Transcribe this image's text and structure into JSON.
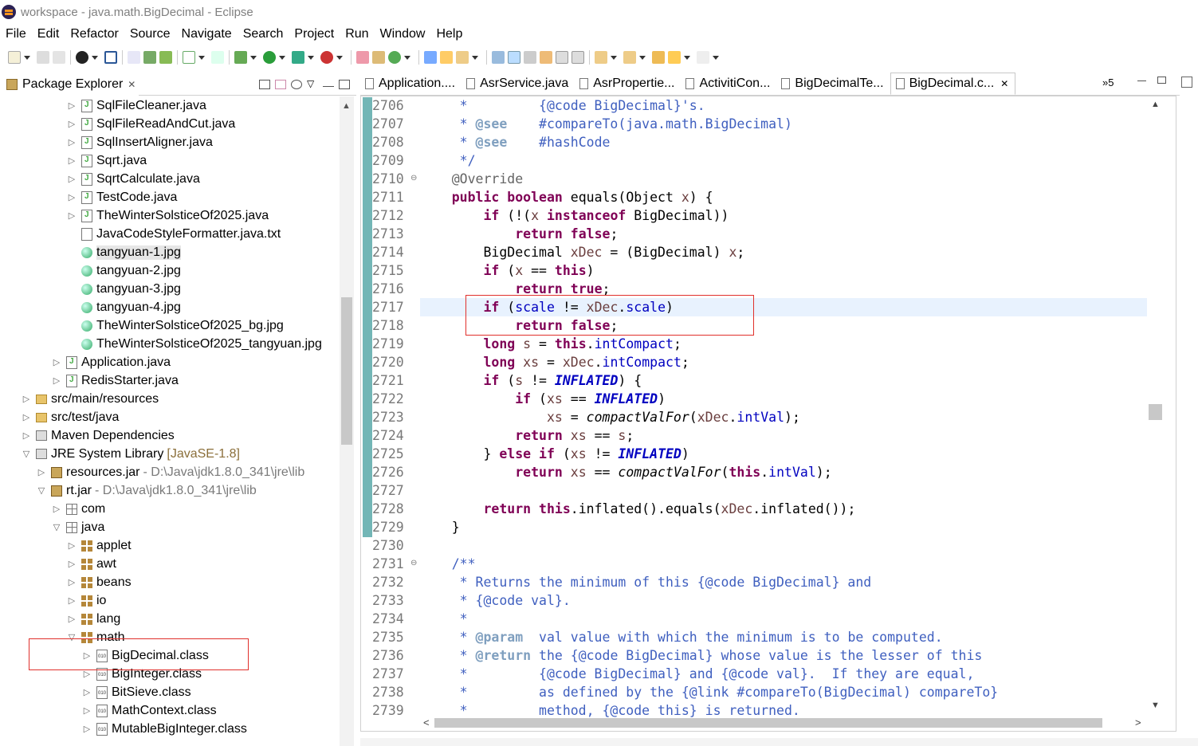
{
  "window": {
    "title": "workspace - java.math.BigDecimal - Eclipse"
  },
  "menu": [
    "File",
    "Edit",
    "Refactor",
    "Source",
    "Navigate",
    "Search",
    "Project",
    "Run",
    "Window",
    "Help"
  ],
  "package_explorer": {
    "title": "Package Explorer",
    "items": [
      {
        "label": "SqlFileCleaner.java",
        "icon": "java-file-icon"
      },
      {
        "label": "SqlFileReadAndCut.java",
        "icon": "java-file-icon"
      },
      {
        "label": "SqlInsertAligner.java",
        "icon": "java-file-icon"
      },
      {
        "label": "Sqrt.java",
        "icon": "java-file-icon"
      },
      {
        "label": "SqrtCalculate.java",
        "icon": "java-file-icon"
      },
      {
        "label": "TestCode.java",
        "icon": "java-file-icon"
      },
      {
        "label": "TheWinterSolsticeOf2025.java",
        "icon": "java-file-icon"
      },
      {
        "label": "JavaCodeStyleFormatter.java.txt",
        "icon": "text-file-icon"
      },
      {
        "label": "tangyuan-1.jpg",
        "icon": "image-file-icon"
      },
      {
        "label": "tangyuan-2.jpg",
        "icon": "image-file-icon"
      },
      {
        "label": "tangyuan-3.jpg",
        "icon": "image-file-icon"
      },
      {
        "label": "tangyuan-4.jpg",
        "icon": "image-file-icon"
      },
      {
        "label": "TheWinterSolsticeOf2025_bg.jpg",
        "icon": "image-file-icon"
      },
      {
        "label": "TheWinterSolsticeOf2025_tangyuan.jpg",
        "icon": "image-file-icon"
      },
      {
        "label": "Application.java",
        "icon": "java-file-icon"
      },
      {
        "label": "RedisStarter.java",
        "icon": "java-file-icon"
      },
      {
        "label": "src/main/resources",
        "icon": "source-folder-icon"
      },
      {
        "label": "src/test/java",
        "icon": "source-folder-icon"
      },
      {
        "label": "Maven Dependencies",
        "icon": "library-icon"
      },
      {
        "label": "JRE System Library",
        "suffix": "[JavaSE-1.8]",
        "icon": "library-icon"
      },
      {
        "label": "resources.jar",
        "path": "- D:\\Java\\jdk1.8.0_341\\jre\\lib",
        "icon": "jar-icon"
      },
      {
        "label": "rt.jar",
        "path": "- D:\\Java\\jdk1.8.0_341\\jre\\lib",
        "icon": "jar-icon"
      },
      {
        "label": "com",
        "icon": "package-icon"
      },
      {
        "label": "java",
        "icon": "package-icon"
      },
      {
        "label": "applet",
        "icon": "package-icon"
      },
      {
        "label": "awt",
        "icon": "package-icon"
      },
      {
        "label": "beans",
        "icon": "package-icon"
      },
      {
        "label": "io",
        "icon": "package-icon"
      },
      {
        "label": "lang",
        "icon": "package-icon"
      },
      {
        "label": "math",
        "icon": "package-icon"
      },
      {
        "label": "BigDecimal.class",
        "icon": "class-file-icon"
      },
      {
        "label": "BigInteger.class",
        "icon": "class-file-icon"
      },
      {
        "label": "BitSieve.class",
        "icon": "class-file-icon"
      },
      {
        "label": "MathContext.class",
        "icon": "class-file-icon"
      },
      {
        "label": "MutableBigInteger.class",
        "icon": "class-file-icon"
      }
    ]
  },
  "editor": {
    "tabs": [
      "Application....",
      "AsrService.java",
      "AsrPropertie...",
      "ActivitiCon...",
      "BigDecimalTe...",
      "BigDecimal.c..."
    ],
    "more_tabs": "»5",
    "line_numbers": [
      "2706",
      "2707",
      "2708",
      "2709",
      "2710",
      "2711",
      "2712",
      "2713",
      "2714",
      "2715",
      "2716",
      "2717",
      "2718",
      "2719",
      "2720",
      "2721",
      "2722",
      "2723",
      "2724",
      "2725",
      "2726",
      "2727",
      "2728",
      "2729",
      "2730",
      "2731",
      "2732",
      "2733",
      "2734",
      "2735",
      "2736",
      "2737",
      "2738",
      "2739"
    ]
  },
  "code_lines": [
    "     *         {@code BigDecimal}'s.",
    "     * @see    #compareTo(java.math.BigDecimal)",
    "     * @see    #hashCode",
    "     */",
    "    @Override",
    "    public boolean equals(Object x) {",
    "        if (!(x instanceof BigDecimal))",
    "            return false;",
    "        BigDecimal xDec = (BigDecimal) x;",
    "        if (x == this)",
    "            return true;",
    "        if (scale != xDec.scale)",
    "            return false;",
    "        long s = this.intCompact;",
    "        long xs = xDec.intCompact;",
    "        if (s != INFLATED) {",
    "            if (xs == INFLATED)",
    "                xs = compactValFor(xDec.intVal);",
    "            return xs == s;",
    "        } else if (xs != INFLATED)",
    "            return xs == compactValFor(this.intVal);",
    "",
    "        return this.inflated().equals(xDec.inflated());",
    "    }",
    "",
    "    /**",
    "     * Returns the minimum of this {@code BigDecimal} and",
    "     * {@code val}.",
    "     *",
    "     * @param  val value with which the minimum is to be computed.",
    "     * @return the {@code BigDecimal} whose value is the lesser of this",
    "     *         {@code BigDecimal} and {@code val}.  If they are equal,",
    "     *         as defined by the {@link #compareTo(BigDecimal) compareTo}",
    "     *         method, {@code this} is returned."
  ],
  "colors": {
    "keyword": "#7f0055",
    "comment": "#3f5fbf",
    "field": "#0000c0",
    "annotation_box": "#e0302c",
    "current_line": "#e8f2fe"
  }
}
